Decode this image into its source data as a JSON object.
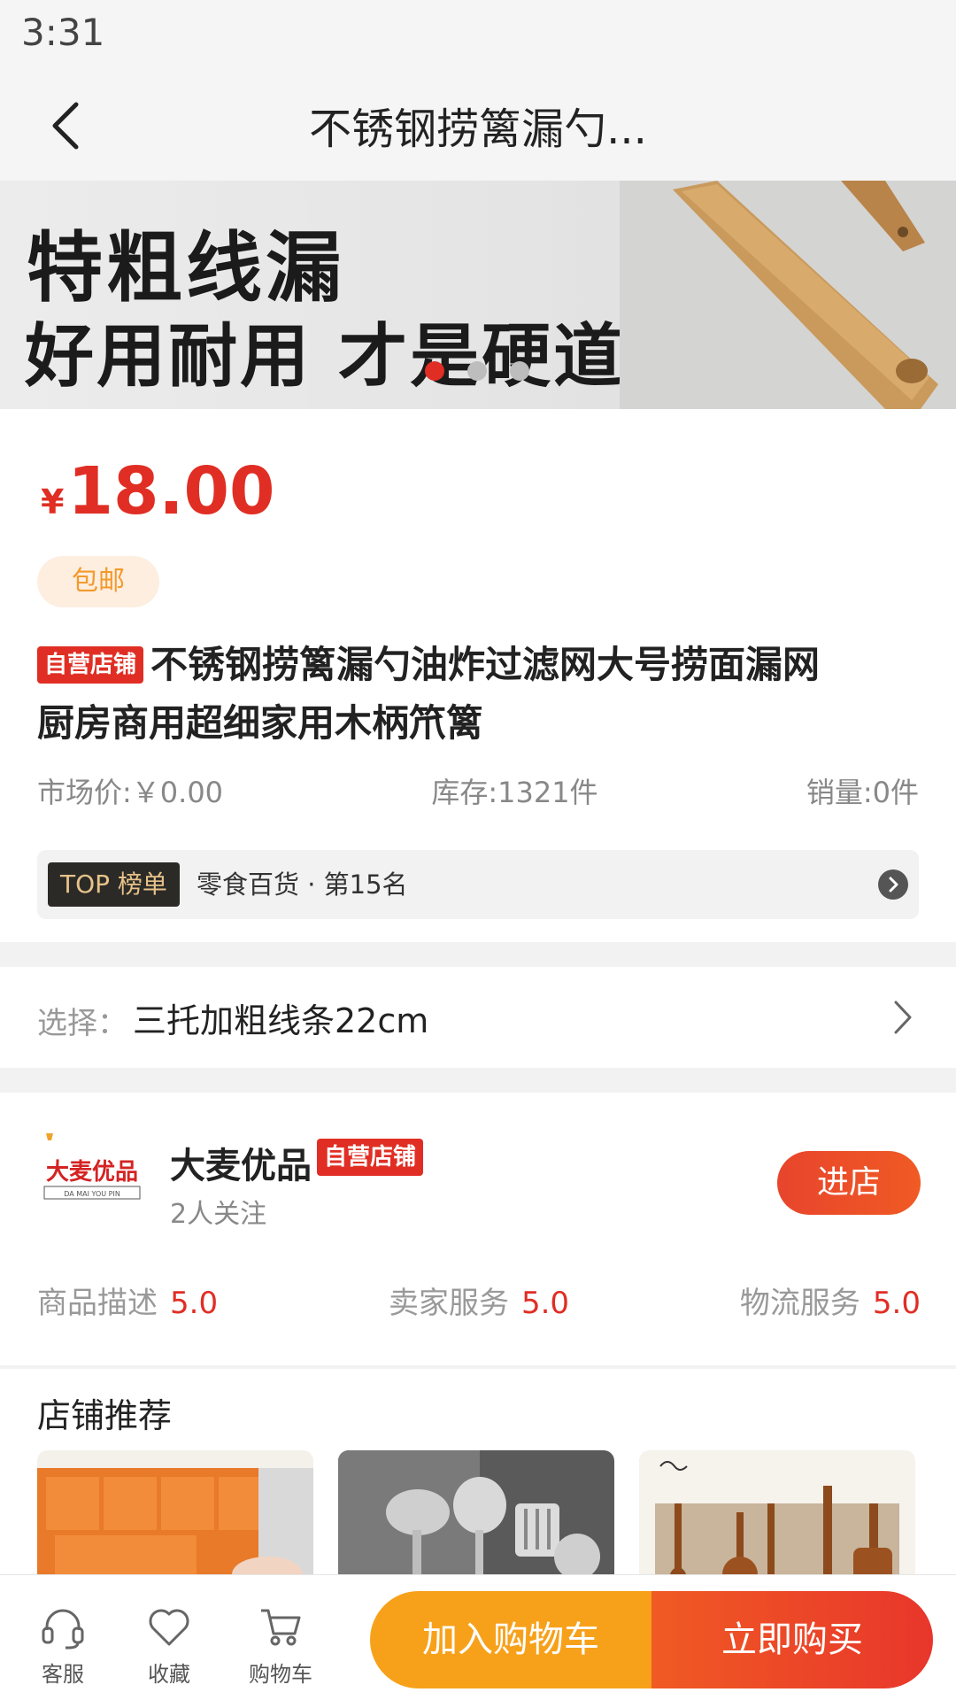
{
  "status_bar": {
    "time": "3:31"
  },
  "nav": {
    "title": "不锈钢捞篱漏勺..."
  },
  "banner": {
    "line1": "特粗线漏",
    "line2": "好用耐用 才是硬道理",
    "slide_count": 3,
    "active_slide": 1
  },
  "product": {
    "currency": "¥",
    "price": "18.00",
    "shipping_badge": "包邮",
    "title_tag": "自营店铺",
    "title": "不锈钢捞篱漏勺油炸过滤网大号捞面漏网厨房商用超细家用木柄笊篱",
    "market_price": "市场价:￥0.00",
    "stock": "库存:1321件",
    "sales": "销量:0件",
    "top_badge": "TOP 榜单",
    "top_text": "零食百货 · 第15名"
  },
  "select": {
    "label": "选择：",
    "value": "三托加粗线条22cm"
  },
  "store": {
    "logo_text": "大麦优品",
    "logo_subtext": "DA MAI YOU PIN",
    "name": "大麦优品",
    "tag": "自营店铺",
    "followers": "2人关注",
    "enter_label": "进店",
    "ratings": [
      {
        "label": "商品描述",
        "value": "5.0"
      },
      {
        "label": "卖家服务",
        "value": "5.0"
      },
      {
        "label": "物流服务",
        "value": "5.0"
      }
    ]
  },
  "recommend": {
    "title": "店铺推荐"
  },
  "bottom": {
    "service_label": "客服",
    "favorite_label": "收藏",
    "cart_label": "购物车",
    "add_cart_label": "加入购物车",
    "buy_label": "立即购买"
  },
  "colors": {
    "accent": "#e02e24",
    "cart_button": "#f7a11b",
    "buy_button": "#e8362b"
  }
}
